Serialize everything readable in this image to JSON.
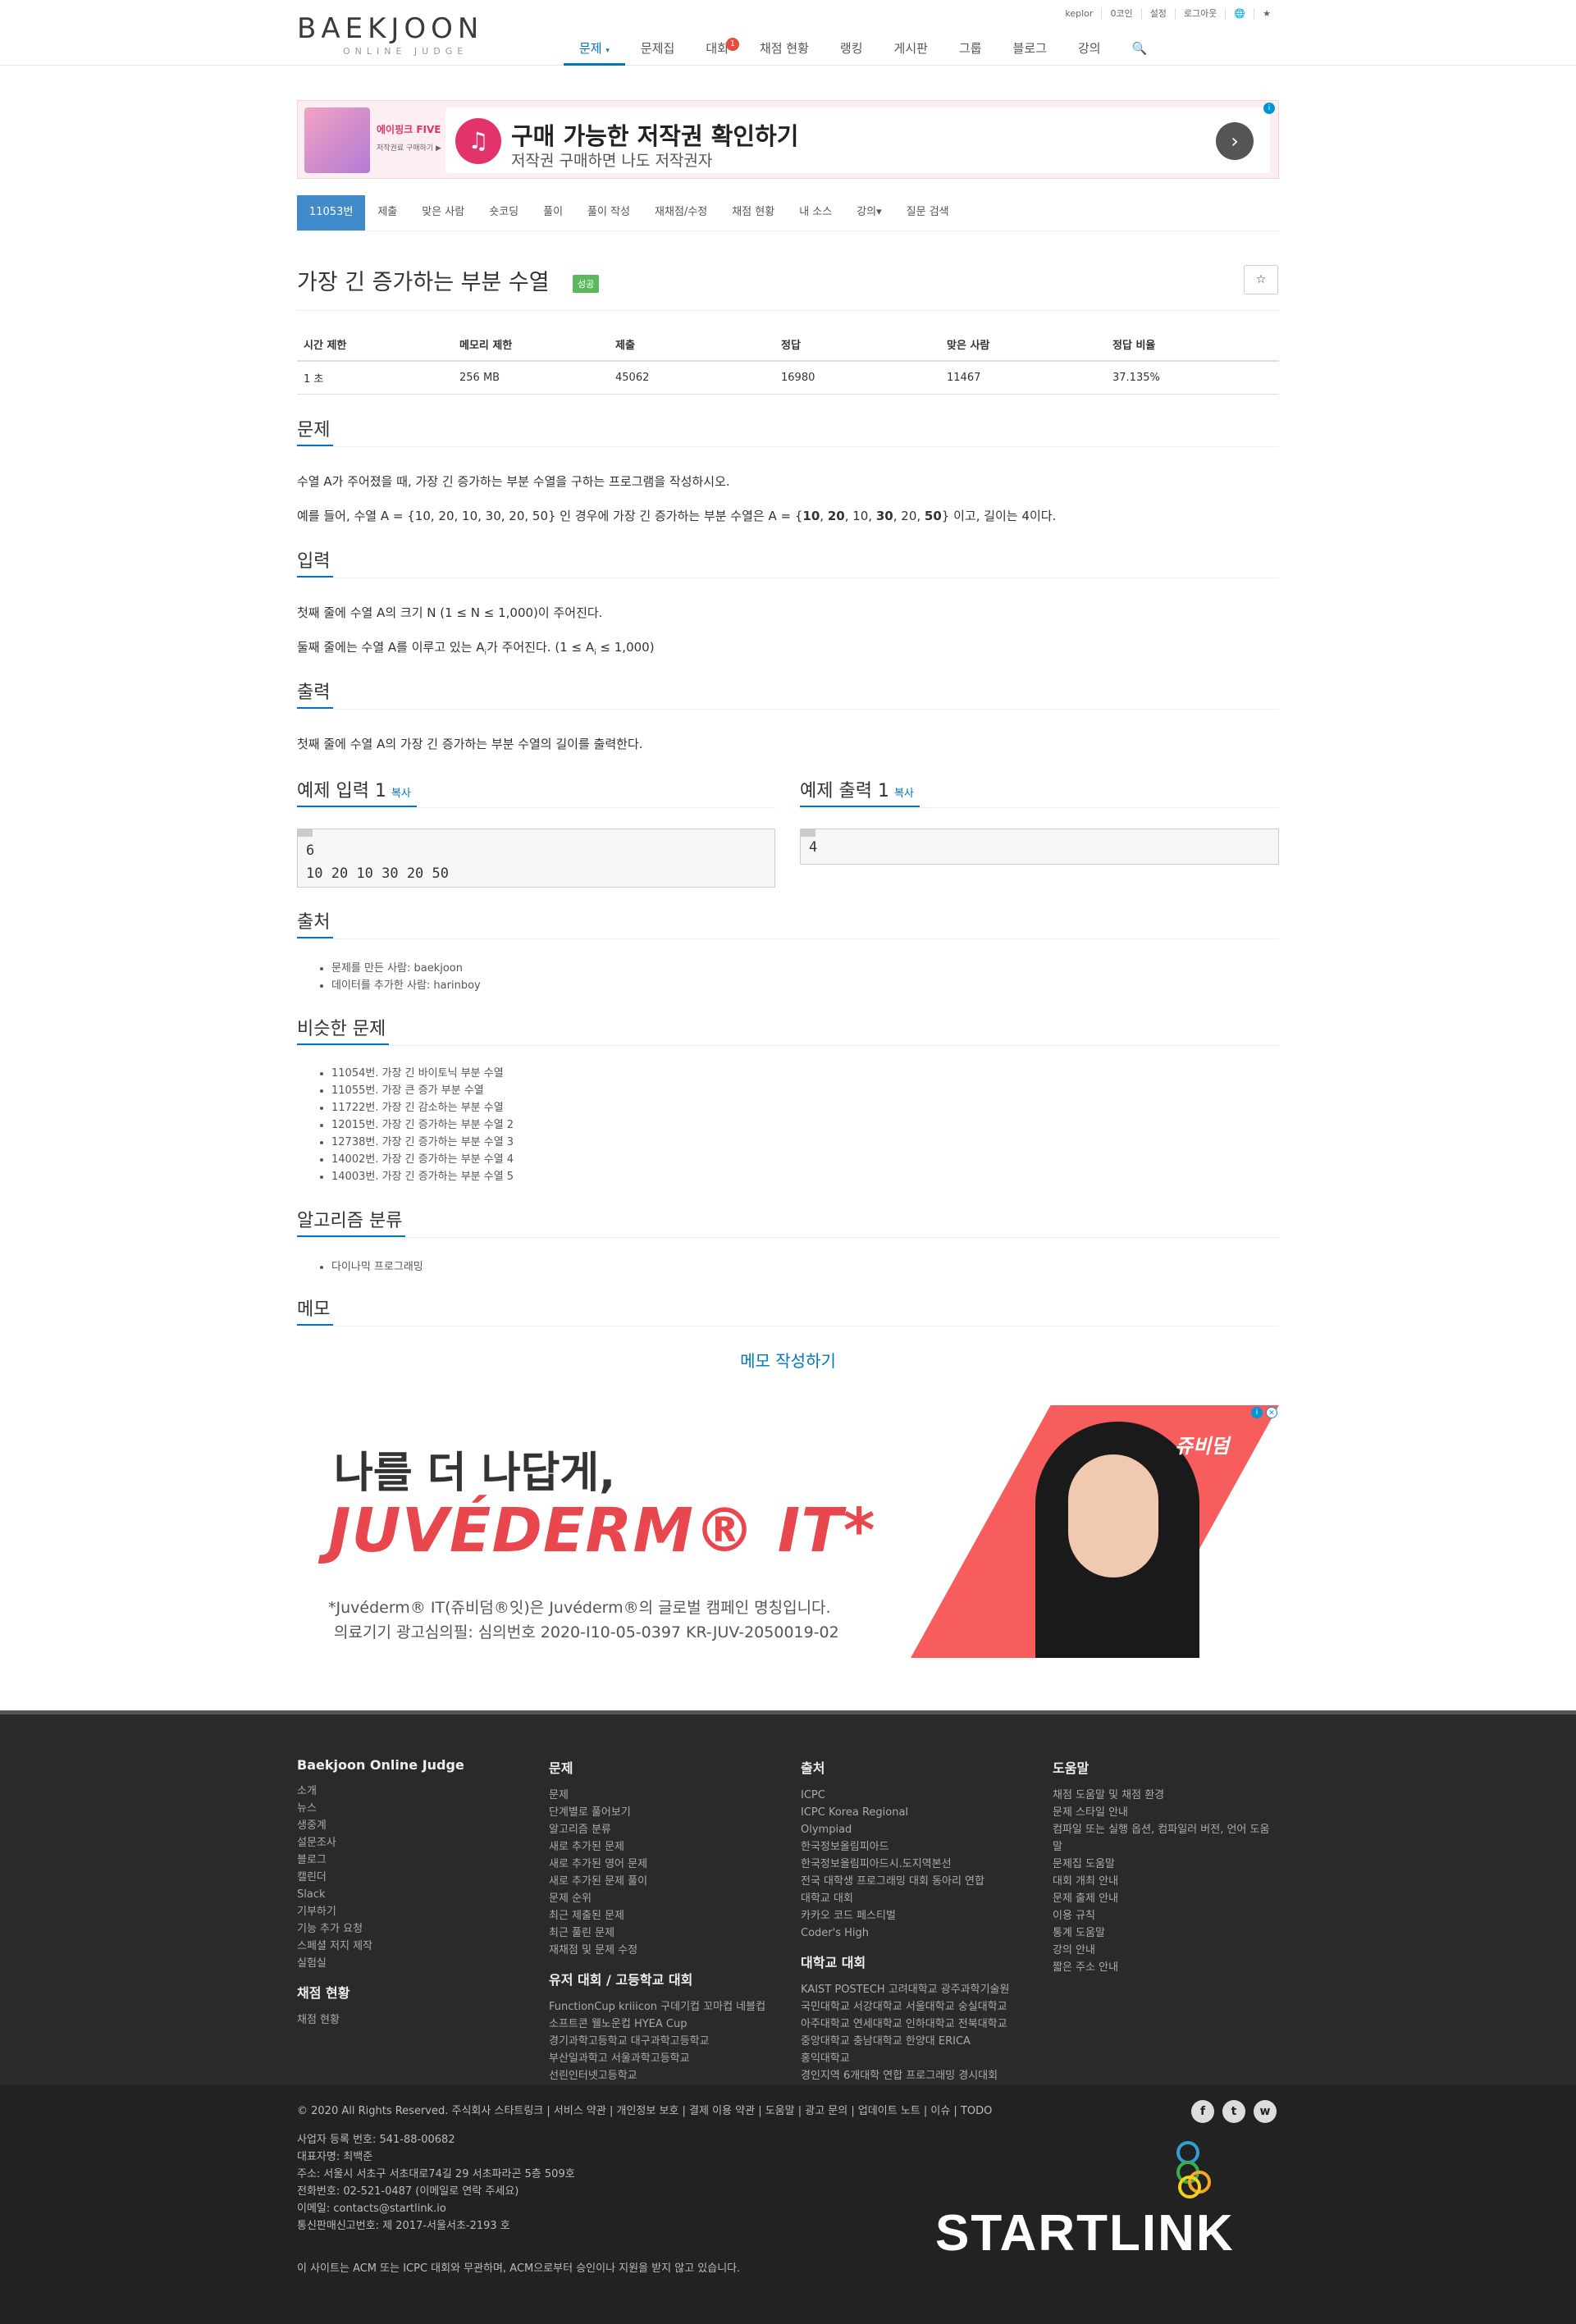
{
  "header": {
    "logo_main": "BAEKJOON",
    "logo_sub": "ONLINE JUDGE",
    "topbar": [
      "keplor",
      "0코인",
      "설정",
      "로그아웃",
      "🌐",
      "★"
    ],
    "nav": [
      {
        "label": "문제",
        "active": true
      },
      {
        "label": "문제집"
      },
      {
        "label": "대회",
        "badge": "1"
      },
      {
        "label": "채점 현황"
      },
      {
        "label": "랭킹"
      },
      {
        "label": "게시판"
      },
      {
        "label": "그룹"
      },
      {
        "label": "블로그"
      },
      {
        "label": "강의"
      }
    ]
  },
  "ad1": {
    "thumb_label": "에이핑크 FIVE",
    "thumb_sub": "저작권료 구매하기 ▶",
    "title": "구매 가능한 저작권 확인하기",
    "desc": "저작권 구매하면 나도 저작권자",
    "arrow": "›"
  },
  "problem_menu": [
    "11053번",
    "제출",
    "맞은 사람",
    "숏코딩",
    "풀이",
    "풀이 작성",
    "재채점/수정",
    "채점 현황",
    "내 소스",
    "강의▾",
    "질문 검색"
  ],
  "problem": {
    "title": "가장 긴 증가하는 부분 수열",
    "badge": "성공",
    "star": "☆",
    "info_headers": [
      "시간 제한",
      "메모리 제한",
      "제출",
      "정답",
      "맞은 사람",
      "정답 비율"
    ],
    "info_values": [
      "1 초",
      "256 MB",
      "45062",
      "16980",
      "11467",
      "37.135%"
    ]
  },
  "sections": {
    "problem_heading": "문제",
    "problem_p1": "수열 A가 주어졌을 때, 가장 긴 증가하는 부분 수열을 구하는 프로그램을 작성하시오.",
    "problem_p2_a": "예를 들어, 수열 A = {10, 20, 10, 30, 20, 50} 인 경우에 가장 긴 증가하는 부분 수열은 A = {",
    "problem_p2_b1": "10",
    "problem_p2_c1": ", ",
    "problem_p2_b2": "20",
    "problem_p2_c2": ", 10, ",
    "problem_p2_b3": "30",
    "problem_p2_c3": ", 20, ",
    "problem_p2_b4": "50",
    "problem_p2_d": "} 이고, 길이는 4이다.",
    "input_heading": "입력",
    "input_p1": "첫째 줄에 수열 A의 크기 N (1 ≤ N ≤ 1,000)이 주어진다.",
    "input_p2_a": "둘째 줄에는 수열 A를 이루고 있는 A",
    "input_p2_sub": "i",
    "input_p2_b": "가 주어진다. (1 ≤ A",
    "input_p2_sub2": "i",
    "input_p2_c": " ≤ 1,000)",
    "output_heading": "출력",
    "output_p1": "첫째 줄에 수열 A의 가장 긴 증가하는 부분 수열의 길이를 출력한다.",
    "sample_input_heading": "예제 입력 1",
    "sample_output_heading": "예제 출력 1",
    "copy_label": "복사",
    "sample_input": "6\n10 20 10 30 20 50",
    "sample_output": "4",
    "source_heading": "출처",
    "source_items": [
      "문제를 만든 사람: baekjoon",
      "데이터를 추가한 사람: harinboy"
    ],
    "similar_heading": "비슷한 문제",
    "similar_items": [
      "11054번. 가장 긴 바이토닉 부분 수열",
      "11055번. 가장 큰 증가 부분 수열",
      "11722번. 가장 긴 감소하는 부분 수열",
      "12015번. 가장 긴 증가하는 부분 수열 2",
      "12738번. 가장 긴 증가하는 부분 수열 3",
      "14002번. 가장 긴 증가하는 부분 수열 4",
      "14003번. 가장 긴 증가하는 부분 수열 5"
    ],
    "algo_heading": "알고리즘 분류",
    "algo_items": [
      "다이나믹 프로그래밍"
    ],
    "memo_heading": "메모",
    "memo_link": "메모 작성하기"
  },
  "ad2": {
    "headline": "나를 더 나답게,",
    "brand": "JUVÉDERM® IT*",
    "note": "*Juvéderm® IT(쥬비덤®잇)은 Juvéderm®의 글로벌 캠페인 명칭입니다.",
    "reg": "의료기기 광고심의필: 심의번호 2020-I10-05-0397  KR-JUV-2050019-02",
    "tag": "쥬비덤"
  },
  "footer": {
    "col1_title": "Baekjoon Online Judge",
    "col1_items": [
      "소개",
      "뉴스",
      "생중계",
      "설문조사",
      "블로그",
      "캘린더",
      "Slack",
      "기부하기",
      "기능 추가 요청",
      "스페셜 저지 제작",
      "실험실"
    ],
    "col1_sub_title": "채점 현황",
    "col1_sub_items": [
      "채점 현황"
    ],
    "col2_title": "문제",
    "col2_items": [
      "문제",
      "단계별로 풀어보기",
      "알고리즘 분류",
      "새로 추가된 문제",
      "새로 추가된 영어 문제",
      "새로 추가된 문제 풀이",
      "문제 순위",
      "최근 제출된 문제",
      "최근 풀린 문제",
      "재채점 및 문제 수정"
    ],
    "col2_sub_title": "유저 대회 / 고등학교 대회",
    "col2_sub_items": [
      "FunctionCup  kriiicon  구데기컵  꼬마컵  네블컵",
      "소프트콘  웰노운컵  HYEA Cup",
      "경기과학고등학교  대구과학고등학교",
      "부산일과학고  서울과학고등학교",
      "선린인터넷고등학교"
    ],
    "col3_title": "출처",
    "col3_items": [
      "ICPC",
      "ICPC Korea Regional",
      "Olympiad",
      "한국정보올림피아드",
      "한국정보올림피아드시.도지역본선",
      "전국 대학생 프로그래밍 대회 동아리 연합",
      "대학교 대회",
      "카카오 코드 페스티벌",
      "Coder's High"
    ],
    "col3_sub_title": "대학교 대회",
    "col3_sub_items": [
      "KAIST  POSTECH  고려대학교  광주과학기술원",
      "국민대학교  서강대학교  서울대학교  숭실대학교",
      "아주대학교  연세대학교  인하대학교  전북대학교",
      "중앙대학교  충남대학교  한양대 ERICA",
      "홍익대학교",
      "경인지역 6개대학 연합 프로그래밍 경시대회"
    ],
    "col4_title": "도움말",
    "col4_items": [
      "채점 도움말 및 채점 환경",
      "문제 스타일 안내",
      "컴파일 또는 실행 옵션, 컴파일러 버전, 언어 도움",
      "말",
      "문제집 도움말",
      "대회 개최 안내",
      "문제 출제 안내",
      "이용 규칙",
      "통계 도움말",
      "강의 안내",
      "짧은 주소 안내"
    ],
    "bottom_links": "© 2020 All Rights Reserved. 주식회사 스타트링크  |  서비스 약관  |  개인정보 보호  |  결제 이용 약관  |  도움말  |  광고 문의  |  업데이트 노트  |  이슈  |  TODO",
    "info": [
      "사업자 등록 번호: 541-88-00682",
      "대표자명: 최백준",
      "주소: 서울시 서초구 서초대로74길 29 서초파라곤 5층 509호",
      "전화번호: 02-521-0487 (이메일로 연락 주세요)",
      "이메일: contacts@startlink.io",
      "통신판매신고번호: 제 2017-서울서초-2193 호"
    ],
    "disclaimer": "이 사이트는 ACM 또는 ICPC 대회와 무관하며, ACM으로부터 승인이나 지원을 받지 않고 있습니다.",
    "social": [
      "f",
      "t",
      "w"
    ],
    "startlink": "STARTLINK"
  }
}
